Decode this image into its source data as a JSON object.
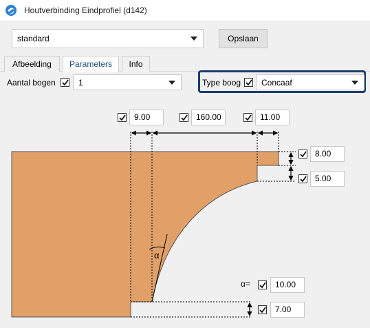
{
  "window": {
    "title": "Houtverbinding Eindprofiel (d142)",
    "icon": "app-logo-icon"
  },
  "top": {
    "profile_value": "standard",
    "save_label": "Opslaan"
  },
  "tabs": [
    {
      "label": "Afbeelding",
      "active": false
    },
    {
      "label": "Parameters",
      "active": true
    },
    {
      "label": "Info",
      "active": false
    }
  ],
  "params": {
    "aantal_bogen_label": "Aantal bogen",
    "aantal_bogen_checked": true,
    "aantal_bogen_value": "1",
    "type_boog_label": "Type boog",
    "type_boog_checked": true,
    "type_boog_value": "Concaaf"
  },
  "dimensions": {
    "top_left": "9.00",
    "top_middle": "160.00",
    "top_right": "11.00",
    "right_upper": "8.00",
    "right_lower": "5.00",
    "alpha_label": "α=",
    "alpha_value": "10.00",
    "bottom": "7.00",
    "angle_symbol": "α"
  },
  "colors": {
    "profile_fill": "#e0a068",
    "highlight_border": "#1a3e6b",
    "active_tab_text": "#1f4e79"
  }
}
